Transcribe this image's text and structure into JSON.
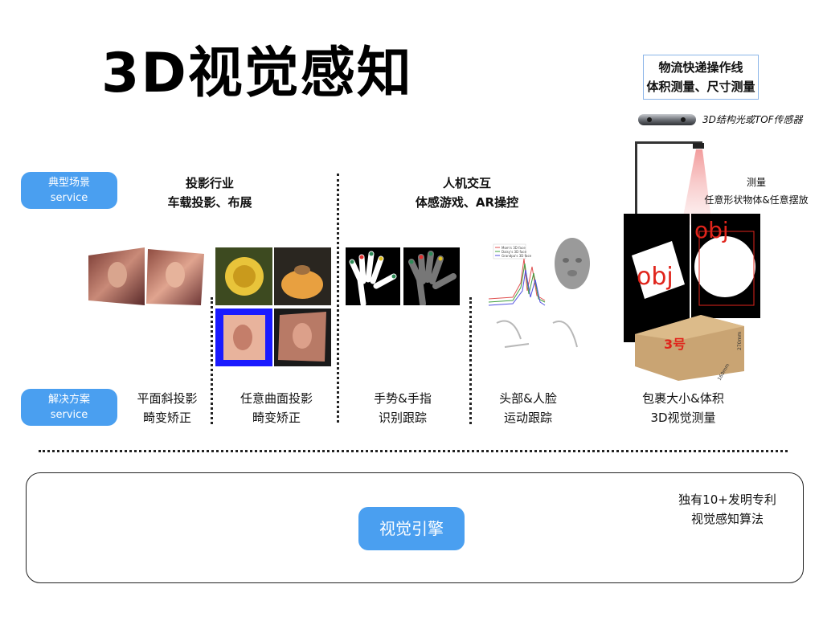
{
  "title": "3D视觉感知",
  "labels": {
    "scenario_line1": "典型场景",
    "scenario_line2": "service",
    "solution_line1": "解决方案",
    "solution_line2": "service"
  },
  "top_box": {
    "line1": "物流快递操作线",
    "line2": "体积测量、尺寸测量"
  },
  "sensor_label": "3D结构光或TOF传感器",
  "measure_label": {
    "line1": "测量",
    "line2": "任意形状物体&任意摆放"
  },
  "categories": [
    {
      "line1": "投影行业",
      "line2": "车载投影、布展"
    },
    {
      "line1": "人机交互",
      "line2": "体感游戏、AR操控"
    }
  ],
  "solutions": [
    {
      "line1": "平面斜投影",
      "line2": "畸变矫正"
    },
    {
      "line1": "任意曲面投影",
      "line2": "畸变矫正"
    },
    {
      "line1": "手势&手指",
      "line2": "识别跟踪"
    },
    {
      "line1": "头部&人脸",
      "line2": "运动跟踪"
    },
    {
      "line1": "包裹大小&体积",
      "line2": "3D视觉测量"
    }
  ],
  "image_text": {
    "obj1": "obj",
    "obj2": "obj",
    "box_number": "3号",
    "box_dim1": "270mm",
    "box_dim2": "160mm",
    "legend1": "Mom's 3D face",
    "legend2": "Daisy's 3D face",
    "legend3": "Grandpa's 3D face"
  },
  "engine": {
    "button": "视觉引擎",
    "note_line1": "独有10+发明专利",
    "note_line2": "视觉感知算法"
  },
  "colors": {
    "accent": "#4a9ff0",
    "obj_red": "#e0241b"
  }
}
